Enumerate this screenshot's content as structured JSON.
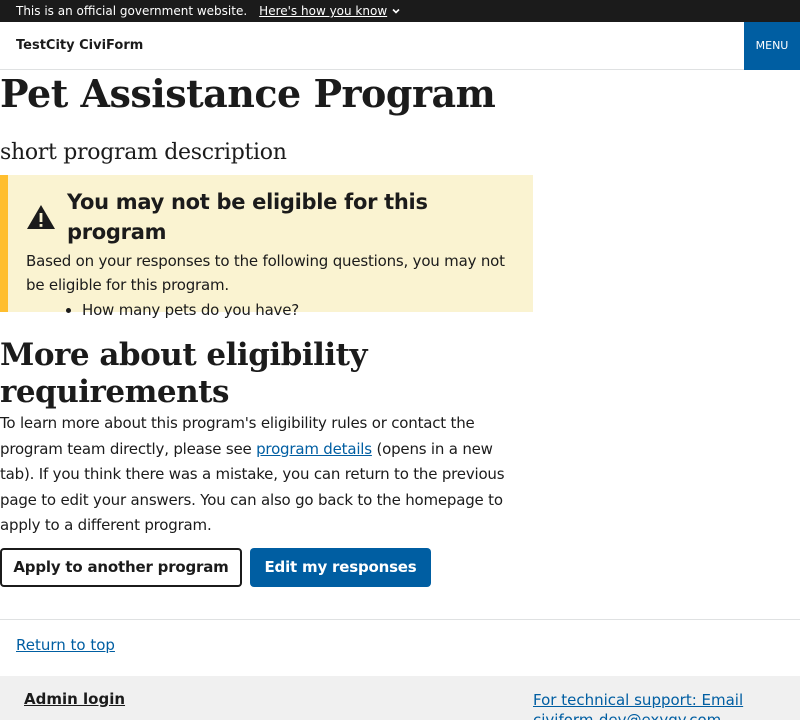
{
  "gov_banner": {
    "text": "This is an official government website.",
    "link_label": "Here's how you know"
  },
  "header": {
    "site_title": "TestCity CiviForm",
    "menu_label": "MENU"
  },
  "program": {
    "title": "Pet Assistance Program",
    "description": "short program description"
  },
  "alert": {
    "title": "You may not be eligible for this program",
    "body": "Based on your responses to the following questions, you may not be eligible for this program.",
    "questions": [
      "How many pets do you have?"
    ]
  },
  "more": {
    "heading": "More about eligibility requirements",
    "text_before_link": "To learn more about this program's eligibility rules or contact the program team directly, please see ",
    "link_label": "program details",
    "text_after_link": " (opens in a new tab). If you think there was a mistake, you can return to the previous page to edit your answers. You can also go back to the homepage to apply to a different program."
  },
  "buttons": {
    "apply_other": "Apply to another program",
    "edit_responses": "Edit my responses"
  },
  "footer": {
    "return_to_top": "Return to top",
    "admin_login": "Admin login",
    "tech_support": "For technical support: Email civiform-dev@exygy.com"
  },
  "colors": {
    "primary": "#005ea2",
    "alert_bg": "#faf3d1",
    "alert_border": "#ffbe2e",
    "banner_bg": "#1b1b1b"
  }
}
